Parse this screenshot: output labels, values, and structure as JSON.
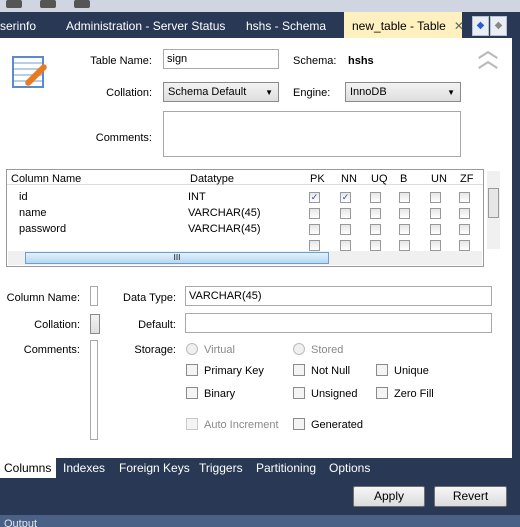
{
  "tabs": [
    {
      "label": "serinfo"
    },
    {
      "label": "Administration - Server Status"
    },
    {
      "label": "hshs - Schema"
    },
    {
      "label": "new_table - Table",
      "active": true
    }
  ],
  "form": {
    "table_name_label": "Table Name:",
    "table_name": "sign",
    "schema_label": "Schema:",
    "schema": "hshs",
    "collation_label": "Collation:",
    "collation": "Schema Default",
    "engine_label": "Engine:",
    "engine": "InnoDB",
    "comments_label": "Comments:",
    "comments": ""
  },
  "grid": {
    "headers": [
      "Column Name",
      "Datatype",
      "PK",
      "NN",
      "UQ",
      "B",
      "UN",
      "ZF"
    ],
    "rows": [
      {
        "name": "id",
        "type": "INT",
        "flags": [
          true,
          true,
          false,
          false,
          false,
          false
        ]
      },
      {
        "name": "name",
        "type": "VARCHAR(45)",
        "flags": [
          false,
          false,
          false,
          false,
          false,
          false
        ]
      },
      {
        "name": "password",
        "type": "VARCHAR(45)",
        "flags": [
          false,
          false,
          false,
          false,
          false,
          false
        ]
      },
      {
        "name": "",
        "type": "",
        "flags": [
          false,
          false,
          false,
          false,
          false,
          false
        ]
      }
    ]
  },
  "detail": {
    "column_name_label": "Column Name:",
    "collation_label": "Collation:",
    "comments_label": "Comments:",
    "data_type_label": "Data Type:",
    "data_type": "VARCHAR(45)",
    "default_label": "Default:",
    "default": "",
    "storage_label": "Storage:",
    "virtual": "Virtual",
    "stored": "Stored",
    "primary_key": "Primary Key",
    "not_null": "Not Null",
    "unique": "Unique",
    "binary": "Binary",
    "unsigned": "Unsigned",
    "zero_fill": "Zero Fill",
    "auto_increment": "Auto Increment",
    "generated": "Generated"
  },
  "bottom_tabs": [
    "Columns",
    "Indexes",
    "Foreign Keys",
    "Triggers",
    "Partitioning",
    "Options"
  ],
  "buttons": {
    "apply": "Apply",
    "revert": "Revert"
  },
  "output_label": "Output",
  "colors": {
    "bg": "#293955",
    "active_tab": "#fff0c0"
  }
}
